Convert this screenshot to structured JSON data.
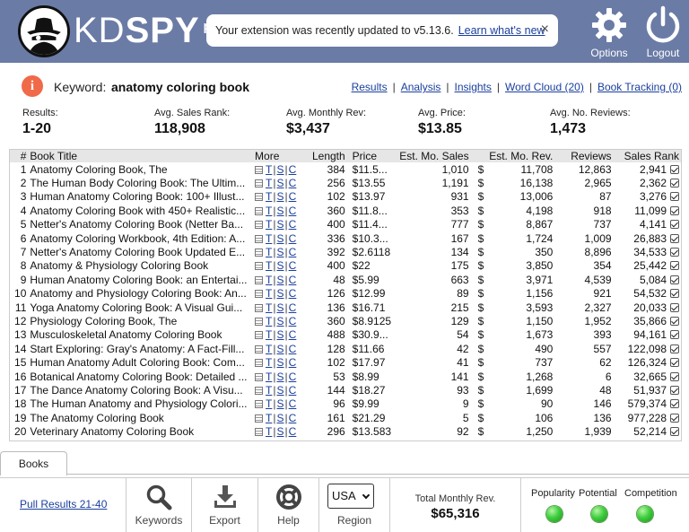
{
  "header": {
    "brand_kd": "KD",
    "brand_spy": "SPY",
    "brand_pro": "pro",
    "notice_text": "Your extension was recently updated to v5.13.6.",
    "notice_link": "Learn what's new",
    "notice_close": "×",
    "options_label": "Options",
    "logout_label": "Logout"
  },
  "keyword": {
    "info_glyph": "i",
    "label": "Keyword:",
    "value": "anatomy coloring book"
  },
  "nav": {
    "results": "Results",
    "analysis": "Analysis",
    "insights": "Insights",
    "word_cloud": "Word Cloud (20)",
    "book_tracking": "Book Tracking (0)",
    "separator": "|"
  },
  "stats": {
    "results_label": "Results:",
    "results_value": "1-20",
    "rank_label": "Avg. Sales Rank:",
    "rank_value": "118,908",
    "rev_label": "Avg. Monthly Rev:",
    "rev_value": "$3,437",
    "price_label": "Avg. Price:",
    "price_value": "$13.85",
    "reviews_label": "Avg. No. Reviews:",
    "reviews_value": "1,473"
  },
  "table": {
    "headers": {
      "num": "#",
      "title": "Book Title",
      "more": "More",
      "length": "Length",
      "price": "Price",
      "sales": "Est. Mo. Sales",
      "rev": "Est. Mo. Rev.",
      "reviews": "Reviews",
      "rank": "Sales Rank"
    },
    "more_links": {
      "t": "T",
      "s": "S",
      "c": "C",
      "sep": "|"
    },
    "currency": "$",
    "rows": [
      {
        "num": "1",
        "title": "Anatomy Coloring Book, The",
        "length": "384",
        "price": "$11.5...",
        "sales": "1,010",
        "rev": "11,708",
        "reviews": "12,863",
        "rank": "2,941"
      },
      {
        "num": "2",
        "title": "The Human Body Coloring Book: The Ultim...",
        "length": "256",
        "price": "$13.55",
        "sales": "1,191",
        "rev": "16,138",
        "reviews": "2,965",
        "rank": "2,362"
      },
      {
        "num": "3",
        "title": "Human Anatomy Coloring Book: 100+ Illust...",
        "length": "102",
        "price": "$13.97",
        "sales": "931",
        "rev": "13,006",
        "reviews": "87",
        "rank": "3,276"
      },
      {
        "num": "4",
        "title": "Anatomy Coloring Book with 450+ Realistic...",
        "length": "360",
        "price": "$11.8...",
        "sales": "353",
        "rev": "4,198",
        "reviews": "918",
        "rank": "11,099"
      },
      {
        "num": "5",
        "title": "Netter's Anatomy Coloring Book (Netter Ba...",
        "length": "400",
        "price": "$11.4...",
        "sales": "777",
        "rev": "8,867",
        "reviews": "737",
        "rank": "4,141"
      },
      {
        "num": "6",
        "title": "Anatomy Coloring Workbook, 4th Edition: A...",
        "length": "336",
        "price": "$10.3...",
        "sales": "167",
        "rev": "1,724",
        "reviews": "1,009",
        "rank": "26,883"
      },
      {
        "num": "7",
        "title": "Netter's Anatomy Coloring Book Updated E...",
        "length": "392",
        "price": "$2.6118",
        "sales": "134",
        "rev": "350",
        "reviews": "8,896",
        "rank": "34,533"
      },
      {
        "num": "8",
        "title": "Anatomy & Physiology Coloring Book",
        "length": "400",
        "price": "$22",
        "sales": "175",
        "rev": "3,850",
        "reviews": "354",
        "rank": "25,442"
      },
      {
        "num": "9",
        "title": "Human Anatomy Coloring Book: an Entertai...",
        "length": "48",
        "price": "$5.99",
        "sales": "663",
        "rev": "3,971",
        "reviews": "4,539",
        "rank": "5,084"
      },
      {
        "num": "10",
        "title": "Anatomy and Physiology Coloring Book: An...",
        "length": "126",
        "price": "$12.99",
        "sales": "89",
        "rev": "1,156",
        "reviews": "921",
        "rank": "54,532"
      },
      {
        "num": "11",
        "title": "Yoga Anatomy Coloring Book: A Visual Gui...",
        "length": "136",
        "price": "$16.71",
        "sales": "215",
        "rev": "3,593",
        "reviews": "2,327",
        "rank": "20,033"
      },
      {
        "num": "12",
        "title": "Physiology Coloring Book, The",
        "length": "360",
        "price": "$8.9125",
        "sales": "129",
        "rev": "1,150",
        "reviews": "1,952",
        "rank": "35,866"
      },
      {
        "num": "13",
        "title": "Musculoskeletal Anatomy Coloring Book",
        "length": "488",
        "price": "$30.9...",
        "sales": "54",
        "rev": "1,673",
        "reviews": "393",
        "rank": "94,161"
      },
      {
        "num": "14",
        "title": "Start Exploring: Gray's Anatomy: A Fact-Fill...",
        "length": "128",
        "price": "$11.66",
        "sales": "42",
        "rev": "490",
        "reviews": "557",
        "rank": "122,098"
      },
      {
        "num": "15",
        "title": "Human Anatomy Adult Coloring Book: Com...",
        "length": "102",
        "price": "$17.97",
        "sales": "41",
        "rev": "737",
        "reviews": "62",
        "rank": "126,324"
      },
      {
        "num": "16",
        "title": "Botanical Anatomy Coloring Book: Detailed ...",
        "length": "53",
        "price": "$8.99",
        "sales": "141",
        "rev": "1,268",
        "reviews": "6",
        "rank": "32,665"
      },
      {
        "num": "17",
        "title": "The Dance Anatomy Coloring Book: A Visu...",
        "length": "144",
        "price": "$18.27",
        "sales": "93",
        "rev": "1,699",
        "reviews": "48",
        "rank": "51,937"
      },
      {
        "num": "18",
        "title": "The Human Anatomy and Physiology Colori...",
        "length": "96",
        "price": "$9.99",
        "sales": "9",
        "rev": "90",
        "reviews": "146",
        "rank": "579,374"
      },
      {
        "num": "19",
        "title": "The Anatomy Coloring Book",
        "length": "161",
        "price": "$21.29",
        "sales": "5",
        "rev": "106",
        "reviews": "136",
        "rank": "977,228"
      },
      {
        "num": "20",
        "title": "Veterinary Anatomy Coloring Book",
        "length": "296",
        "price": "$13.583",
        "sales": "92",
        "rev": "1,250",
        "reviews": "1,939",
        "rank": "52,214"
      }
    ]
  },
  "tabs": {
    "books": "Books"
  },
  "footer": {
    "pull": "Pull Results 21-40",
    "keywords": "Keywords",
    "export": "Export",
    "help": "Help",
    "region_value": "USA",
    "region_label": "Region",
    "total_label": "Total Monthly Rev.",
    "total_value": "$65,316",
    "popularity": "Popularity",
    "potential": "Potential",
    "competition": "Competition"
  },
  "icons": {
    "logo": "spy-logo-icon",
    "options": "gear-icon",
    "logout": "power-icon",
    "info": "info-icon",
    "keywords": "search-icon",
    "export": "download-icon",
    "help": "lifebuoy-icon",
    "meter": "green-light-icon"
  },
  "colors": {
    "header_bg": "#6a7ba6",
    "link": "#1a3f9c",
    "info_icon": "#f06a4a",
    "meter_green": "#3fcf3f"
  }
}
